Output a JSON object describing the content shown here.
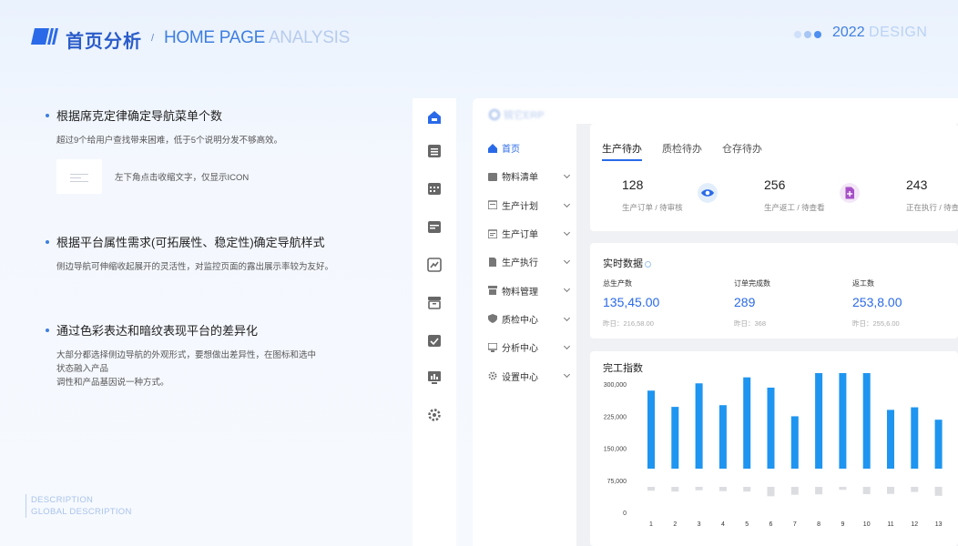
{
  "header": {
    "title": "首页分析",
    "slash": "/",
    "subtitle_a": "HOME PAGE",
    "subtitle_b": " ANALYSIS",
    "year": "2022",
    "design": "DESIGN"
  },
  "points": [
    {
      "title": "根据席克定律确定导航菜单个数",
      "desc": "超过9个给用户查找带来困难，低于5个说明分发不够高效。"
    },
    {
      "title": "根据平台属性需求(可拓展性、稳定性)确定导航样式",
      "desc": "侧边导航可伸缩收起展开的灵活性，对监控页面的露出展示率较为友好。"
    },
    {
      "title": "通过色彩表达和暗纹表现平台的差异化",
      "desc_lines": [
        "大部分都选择侧边导航的外观形式，要想做出差异性，在图标和选中",
        "状态融入产品",
        "调性和产品基因说一种方式。"
      ]
    }
  ],
  "demo_text": "左下角点击收缩文字，仅显示ICON",
  "description": {
    "line1": "DESCRIPTION",
    "line2": "GLOBAL DESCRIPTION"
  },
  "rail_icons": [
    "home-icon",
    "list-icon",
    "calendar-icon",
    "calendar-check-icon",
    "chart-doc-icon",
    "archive-icon",
    "task-icon",
    "monitor-chart-icon",
    "gear-icon"
  ],
  "app": {
    "brand": "锐它ERP",
    "menu": [
      {
        "label": "首页",
        "icon": "home-icon",
        "active": true
      },
      {
        "label": "物料清单",
        "icon": "box-icon"
      },
      {
        "label": "生产计划",
        "icon": "calendar-icon"
      },
      {
        "label": "生产订单",
        "icon": "order-icon"
      },
      {
        "label": "生产执行",
        "icon": "doc-icon"
      },
      {
        "label": "物料管理",
        "icon": "archive-icon"
      },
      {
        "label": "质检中心",
        "icon": "shield-icon"
      },
      {
        "label": "分析中心",
        "icon": "monitor-icon"
      },
      {
        "label": "设置中心",
        "icon": "gear-icon"
      }
    ],
    "tabs": [
      "生产待办",
      "质检待办",
      "仓存待办"
    ],
    "stats": [
      {
        "value": "128",
        "label": "生产订单 / 待审核"
      },
      {
        "value": "256",
        "label": "生产返工 / 待查看"
      },
      {
        "value": "243",
        "label": "正在执行 / 待查"
      }
    ],
    "realtime": {
      "title": "实时数据",
      "items": [
        {
          "label": "总生产数",
          "value": "135,45.00",
          "yesterday": "昨日：216,58.00"
        },
        {
          "label": "订单完成数",
          "value": "289",
          "yesterday": "昨日：368"
        },
        {
          "label": "返工数",
          "value": "253,8.00",
          "yesterday": "昨日：255,6.00"
        }
      ]
    },
    "chart_title": "完工指数"
  },
  "colors": {
    "accent": "#2a6ae8",
    "bar": "#1e95f0",
    "bar_shadow": "#dcdde0"
  },
  "chart_data": {
    "type": "bar",
    "title": "完工指数",
    "categories": [
      "1",
      "2",
      "3",
      "4",
      "5",
      "6",
      "7",
      "8",
      "9",
      "10",
      "11",
      "12",
      "13"
    ],
    "yticks": [
      "300,000",
      "225,000",
      "150,000",
      "75,000",
      "0"
    ],
    "ylim": [
      0,
      300000
    ],
    "series": [
      {
        "values": [
          225000,
          187000,
          242000,
          191000,
          256000,
          232000,
          165000,
          268000,
          266000,
          303000,
          180000,
          186000,
          157000
        ]
      },
      {
        "values": [
          -18000,
          -22000,
          -16000,
          -20000,
          -22000,
          -44000,
          -37000,
          -35000,
          -14000,
          -34000,
          -33000,
          -24000,
          -42000
        ]
      }
    ]
  }
}
